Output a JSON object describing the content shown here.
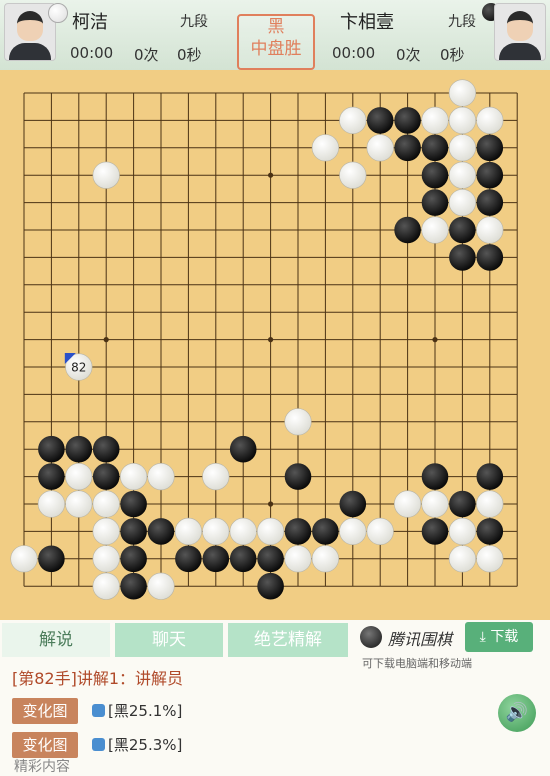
{
  "header": {
    "white_player": {
      "name": "柯洁",
      "rank": "九段",
      "time": "00:00",
      "byoyomi_count": "0次",
      "seconds": "0秒"
    },
    "black_player": {
      "name": "卞相壹",
      "rank": "九段",
      "time": "00:00",
      "byoyomi_count": "0次",
      "seconds": "0秒"
    },
    "result_line1": "黑",
    "result_line2": "中盘胜"
  },
  "board": {
    "size": 19,
    "last_move_label": "82",
    "colors": {
      "board": "#f1cd84",
      "line": "#4b3214",
      "black": "#111111",
      "white": "#f4f4f0",
      "last_move_marker": "#2a50c8"
    },
    "stones": [
      {
        "c": "w",
        "col": 16,
        "row": 0
      },
      {
        "c": "w",
        "col": 12,
        "row": 1
      },
      {
        "c": "b",
        "col": 13,
        "row": 1
      },
      {
        "c": "b",
        "col": 14,
        "row": 1
      },
      {
        "c": "w",
        "col": 15,
        "row": 1
      },
      {
        "c": "w",
        "col": 16,
        "row": 1
      },
      {
        "c": "w",
        "col": 17,
        "row": 1
      },
      {
        "c": "w",
        "col": 11,
        "row": 2
      },
      {
        "c": "w",
        "col": 13,
        "row": 2
      },
      {
        "c": "b",
        "col": 14,
        "row": 2
      },
      {
        "c": "b",
        "col": 15,
        "row": 2
      },
      {
        "c": "w",
        "col": 16,
        "row": 2
      },
      {
        "c": "b",
        "col": 17,
        "row": 2
      },
      {
        "c": "w",
        "col": 3,
        "row": 3
      },
      {
        "c": "w",
        "col": 12,
        "row": 3
      },
      {
        "c": "b",
        "col": 15,
        "row": 3
      },
      {
        "c": "w",
        "col": 16,
        "row": 3
      },
      {
        "c": "b",
        "col": 17,
        "row": 3
      },
      {
        "c": "b",
        "col": 15,
        "row": 4
      },
      {
        "c": "w",
        "col": 16,
        "row": 4
      },
      {
        "c": "b",
        "col": 17,
        "row": 4
      },
      {
        "c": "b",
        "col": 14,
        "row": 5
      },
      {
        "c": "w",
        "col": 15,
        "row": 5
      },
      {
        "c": "b",
        "col": 16,
        "row": 5
      },
      {
        "c": "w",
        "col": 17,
        "row": 5
      },
      {
        "c": "b",
        "col": 16,
        "row": 6
      },
      {
        "c": "b",
        "col": 17,
        "row": 6
      },
      {
        "c": "w",
        "col": 2,
        "row": 10,
        "last": true
      },
      {
        "c": "w",
        "col": 10,
        "row": 12
      },
      {
        "c": "b",
        "col": 1,
        "row": 13
      },
      {
        "c": "b",
        "col": 2,
        "row": 13
      },
      {
        "c": "b",
        "col": 3,
        "row": 13
      },
      {
        "c": "b",
        "col": 8,
        "row": 13
      },
      {
        "c": "b",
        "col": 1,
        "row": 14
      },
      {
        "c": "w",
        "col": 2,
        "row": 14
      },
      {
        "c": "b",
        "col": 3,
        "row": 14
      },
      {
        "c": "w",
        "col": 4,
        "row": 14
      },
      {
        "c": "w",
        "col": 5,
        "row": 14
      },
      {
        "c": "w",
        "col": 7,
        "row": 14
      },
      {
        "c": "b",
        "col": 10,
        "row": 14
      },
      {
        "c": "b",
        "col": 15,
        "row": 14
      },
      {
        "c": "b",
        "col": 17,
        "row": 14
      },
      {
        "c": "w",
        "col": 1,
        "row": 15
      },
      {
        "c": "w",
        "col": 2,
        "row": 15
      },
      {
        "c": "w",
        "col": 3,
        "row": 15
      },
      {
        "c": "b",
        "col": 4,
        "row": 15
      },
      {
        "c": "b",
        "col": 12,
        "row": 15
      },
      {
        "c": "w",
        "col": 14,
        "row": 15
      },
      {
        "c": "w",
        "col": 15,
        "row": 15
      },
      {
        "c": "b",
        "col": 16,
        "row": 15
      },
      {
        "c": "w",
        "col": 17,
        "row": 15
      },
      {
        "c": "w",
        "col": 3,
        "row": 16
      },
      {
        "c": "b",
        "col": 4,
        "row": 16
      },
      {
        "c": "b",
        "col": 5,
        "row": 16
      },
      {
        "c": "w",
        "col": 6,
        "row": 16
      },
      {
        "c": "w",
        "col": 7,
        "row": 16
      },
      {
        "c": "w",
        "col": 8,
        "row": 16
      },
      {
        "c": "w",
        "col": 9,
        "row": 16
      },
      {
        "c": "b",
        "col": 10,
        "row": 16
      },
      {
        "c": "b",
        "col": 11,
        "row": 16
      },
      {
        "c": "w",
        "col": 12,
        "row": 16
      },
      {
        "c": "w",
        "col": 13,
        "row": 16
      },
      {
        "c": "b",
        "col": 15,
        "row": 16
      },
      {
        "c": "w",
        "col": 16,
        "row": 16
      },
      {
        "c": "b",
        "col": 17,
        "row": 16
      },
      {
        "c": "w",
        "col": 0,
        "row": 17
      },
      {
        "c": "b",
        "col": 1,
        "row": 17
      },
      {
        "c": "w",
        "col": 3,
        "row": 17
      },
      {
        "c": "b",
        "col": 4,
        "row": 17
      },
      {
        "c": "b",
        "col": 6,
        "row": 17
      },
      {
        "c": "b",
        "col": 7,
        "row": 17
      },
      {
        "c": "b",
        "col": 8,
        "row": 17
      },
      {
        "c": "b",
        "col": 9,
        "row": 17
      },
      {
        "c": "w",
        "col": 10,
        "row": 17
      },
      {
        "c": "w",
        "col": 11,
        "row": 17
      },
      {
        "c": "w",
        "col": 16,
        "row": 17
      },
      {
        "c": "w",
        "col": 17,
        "row": 17
      },
      {
        "c": "w",
        "col": 3,
        "row": 18
      },
      {
        "c": "b",
        "col": 4,
        "row": 18
      },
      {
        "c": "w",
        "col": 5,
        "row": 18
      },
      {
        "c": "b",
        "col": 9,
        "row": 18
      }
    ]
  },
  "tabs": [
    {
      "label": "解说",
      "active": true
    },
    {
      "label": "聊天",
      "active": false
    },
    {
      "label": "绝艺精解",
      "active": false
    }
  ],
  "brand": {
    "name": "腾讯围棋",
    "subtitle": "可下载电脑端和移动端",
    "download_label": "下载"
  },
  "commentary": {
    "heading": "[第82手]讲解1：讲解员",
    "variations": [
      {
        "button": "变化图",
        "text": "[黑25.1%]"
      },
      {
        "button": "变化图",
        "text": "[黑25.3%]"
      }
    ],
    "more_text": "精彩内容"
  }
}
